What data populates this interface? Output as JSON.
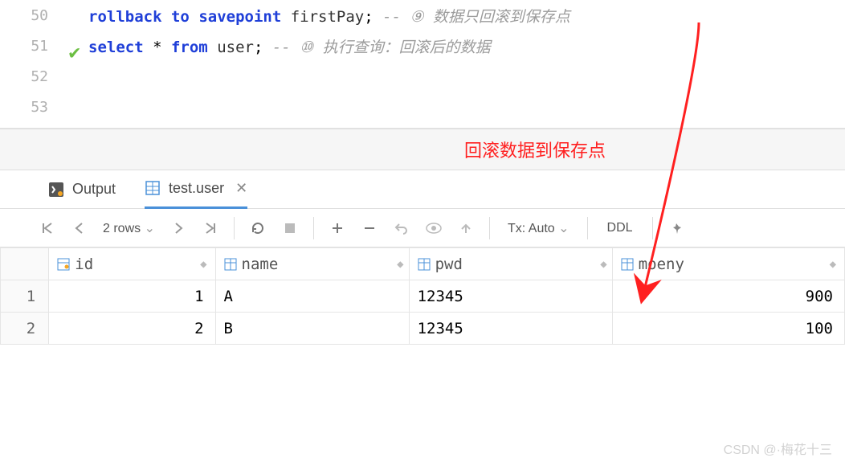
{
  "editor": {
    "lines": [
      {
        "num": "50",
        "check": false,
        "tokens": [
          [
            "kw",
            "rollback"
          ],
          [
            "plain",
            " "
          ],
          [
            "kw",
            "to"
          ],
          [
            "plain",
            " "
          ],
          [
            "kw",
            "savepoint"
          ],
          [
            "plain",
            " "
          ],
          [
            "ident",
            "firstPay"
          ],
          [
            "plain",
            "; "
          ],
          [
            "cmt",
            "-- ⑨ 数据只回滚到保存点"
          ]
        ]
      },
      {
        "num": "51",
        "check": true,
        "tokens": [
          [
            "kw",
            "select"
          ],
          [
            "plain",
            " * "
          ],
          [
            "kw",
            "from"
          ],
          [
            "plain",
            " "
          ],
          [
            "ident",
            "user"
          ],
          [
            "plain",
            "; "
          ],
          [
            "cmt",
            "-- ⑩ 执行查询：回滚后的数据"
          ]
        ]
      },
      {
        "num": "52",
        "check": false,
        "tokens": []
      },
      {
        "num": "53",
        "check": false,
        "tokens": []
      }
    ]
  },
  "annotation": {
    "text": "回滚数据到保存点"
  },
  "tabs": {
    "output_label": "Output",
    "result_label": "test.user"
  },
  "toolbar": {
    "row_summary": "2 rows",
    "tx_label": "Tx: Auto",
    "ddl_label": "DDL"
  },
  "grid": {
    "columns": {
      "id": "id",
      "name": "name",
      "pwd": "pwd",
      "money": "moeny"
    },
    "rows": [
      {
        "n": "1",
        "id": "1",
        "name": "A",
        "pwd": "12345",
        "money": "900"
      },
      {
        "n": "2",
        "id": "2",
        "name": "B",
        "pwd": "12345",
        "money": "100"
      }
    ]
  },
  "watermark": "CSDN @·梅花十三"
}
